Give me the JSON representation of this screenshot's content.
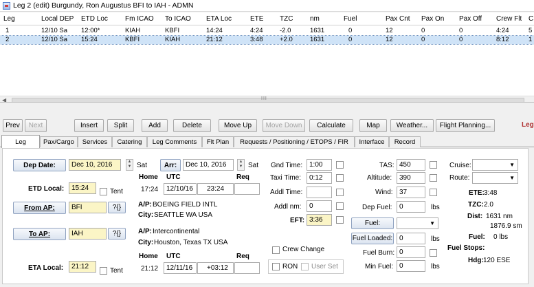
{
  "window": {
    "title": "Leg 2 (edit) Burgundy, Ron Augustus BFI to IAH - ADMN"
  },
  "grid": {
    "columns": [
      "Leg",
      "Local DEP",
      "ETD Loc",
      "Fm ICAO",
      "To ICAO",
      "ETA Loc",
      "ETE",
      "TZC",
      "nm",
      "Fuel",
      "Pax Cnt",
      "Pax On",
      "Pax Off",
      "Crew Flt",
      "C"
    ],
    "rows": [
      [
        "1",
        "12/10 Sa",
        "12:00*",
        "KIAH",
        "KBFI",
        "14:24",
        "4:24",
        "-2.0",
        "1631",
        "0",
        "12",
        "0",
        "0",
        "4:24",
        "5"
      ],
      [
        "2",
        "12/10 Sa",
        "15:24",
        "KBFI",
        "KIAH",
        "21:12",
        "3:48",
        "+2.0",
        "1631",
        "0",
        "12",
        "0",
        "0",
        "8:12",
        "1"
      ]
    ],
    "scroll_grip": "III"
  },
  "toolbar": {
    "prev": "Prev",
    "next": "Next",
    "insert": "Insert",
    "split": "Split",
    "add": "Add",
    "delete": "Delete",
    "move_up": "Move Up",
    "move_down": "Move Down",
    "calculate": "Calculate",
    "map": "Map",
    "weather": "Weather...",
    "flight_planning": "Flight Planning...",
    "cut_label": "Leg"
  },
  "tabs": [
    "Leg",
    "Pax/Cargo",
    "Services",
    "Catering",
    "Leg Comments",
    "Flt Plan",
    "Requests / Positioning / ETOPS / FIR",
    "Interface",
    "Record"
  ],
  "departure": {
    "dep_date_btn": "Dep Date:",
    "dep_date": "Dec 10, 2016",
    "dep_day": "Sat",
    "arr_btn": "Arr:",
    "arr_date": "Dec 10, 2016",
    "arr_day": "Sat",
    "home_lbl": "Home",
    "utc_lbl": "UTC",
    "req_lbl": "Req",
    "etd_local_lbl": "ETD Local:",
    "etd_local": "15:24",
    "tent": "Tent",
    "home_time": "17:24",
    "utc_date": "12/10/16",
    "utc_time": "23:24",
    "from_ap_btn": "From AP:",
    "from_ap": "BFI",
    "lookup": "?{}",
    "ap_lbl": "A/P:",
    "ap_name": "BOEING FIELD INTL",
    "city_lbl": "City:",
    "city": "SEATTLE WA USA"
  },
  "arrival": {
    "to_ap_btn": "To AP:",
    "to_ap": "IAH",
    "lookup": "?{}",
    "ap_lbl": "A/P:",
    "ap_name": "Intercontinental",
    "city_lbl": "City:",
    "city": "Houston, Texas TX USA",
    "home_lbl": "Home",
    "utc_lbl": "UTC",
    "req_lbl": "Req",
    "eta_local_lbl": "ETA Local:",
    "eta_local": "21:12",
    "tent": "Tent",
    "home_time": "21:12",
    "utc_date": "12/11/16",
    "offset": "+03:12"
  },
  "times": {
    "gnd_time_lbl": "Gnd Time:",
    "gnd_time": "1:00",
    "taxi_time_lbl": "Taxi Time:",
    "taxi_time": "0:12",
    "addl_time_lbl": "Addl Time:",
    "addl_time": "",
    "addl_nm_lbl": "Addl nm:",
    "addl_nm": "0",
    "eft_lbl": "EFT:",
    "eft": "3:36",
    "crew_change": "Crew Change",
    "ron": "RON",
    "user_set": "User Set"
  },
  "perf": {
    "tas_lbl": "TAS:",
    "tas": "450",
    "altitude_lbl": "Altitude:",
    "altitude": "390",
    "wind_lbl": "Wind:",
    "wind": "37",
    "dep_fuel_lbl": "Dep Fuel:",
    "dep_fuel": "0",
    "lbs": "lbs",
    "fuel_btn": "Fuel:",
    "fuel_loaded_btn": "Fuel Loaded:",
    "fuel_loaded": "0",
    "fuel_burn_lbl": "Fuel Burn:",
    "fuel_burn": "0",
    "min_fuel_lbl": "Min Fuel:",
    "min_fuel": "0"
  },
  "summary": {
    "cruise_lbl": "Cruise:",
    "route_lbl": "Route:",
    "ete_lbl": "ETE:",
    "ete": "3:48",
    "tzc_lbl": "TZC:",
    "tzc": "2.0",
    "dist_lbl": "Dist:",
    "dist_nm": "1631 nm",
    "dist_sm": "1876.9 sm",
    "fuel_lbl": "Fuel:",
    "fuel": "0 lbs",
    "fuel_stops_lbl": "Fuel Stops:",
    "hdg_lbl": "Hdg:",
    "hdg": "120 ESE"
  }
}
